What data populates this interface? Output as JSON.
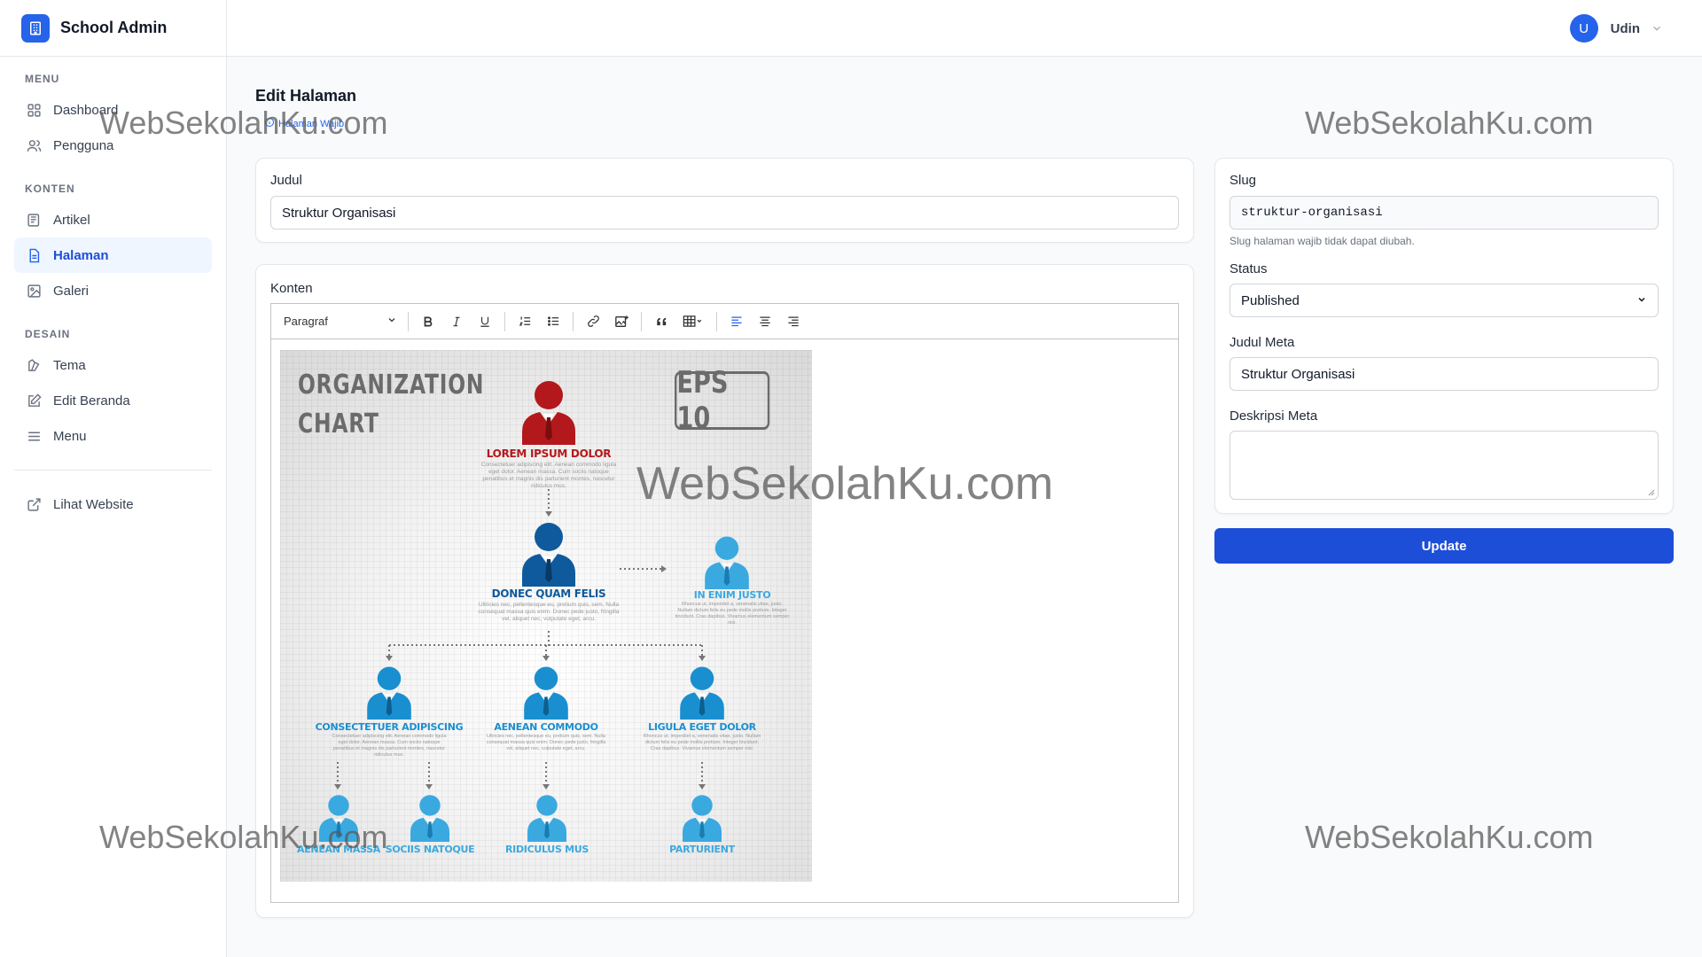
{
  "app": {
    "title": "School Admin"
  },
  "user": {
    "initial": "U",
    "name": "Udin"
  },
  "sidebar": {
    "sections": {
      "menu": "MENU",
      "konten": "KONTEN",
      "desain": "DESAIN"
    },
    "items": [
      {
        "label": "Dashboard",
        "icon": "grid-icon"
      },
      {
        "label": "Pengguna",
        "icon": "users-icon"
      },
      {
        "label": "Artikel",
        "icon": "newspaper-icon"
      },
      {
        "label": "Halaman",
        "icon": "document-icon",
        "active": true
      },
      {
        "label": "Galeri",
        "icon": "image-icon"
      },
      {
        "label": "Tema",
        "icon": "palette-icon"
      },
      {
        "label": "Edit Beranda",
        "icon": "edit-icon"
      },
      {
        "label": "Menu",
        "icon": "menu-lines-icon"
      },
      {
        "label": "Lihat Website",
        "icon": "external-link-icon"
      }
    ]
  },
  "header": {
    "title": "Edit Halaman",
    "badge": "Halaman Wajib"
  },
  "form": {
    "judul_label": "Judul",
    "judul_value": "Struktur Organisasi",
    "konten_label": "Konten",
    "editor": {
      "heading_select": "Paragraf",
      "image": {
        "title_line1": "ORGANIZATION",
        "title_line2": "CHART",
        "eps": "EPS 10",
        "nodes": {
          "top": "LOREM IPSUM DOLOR",
          "second": "DONEC QUAM FELIS",
          "side": "IN ENIM JUSTO",
          "mid1": "CONSECTETUER ADIPISCING",
          "mid2": "AENEAN COMMODO",
          "mid3": "LIGULA EGET DOLOR",
          "bot1": "AENEAN MASSA",
          "bot2": "SOCIIS NATOQUE",
          "bot3": "RIDICULUS MUS",
          "bot4": "PARTURIENT"
        },
        "desc_a": "Consectetuer adipiscing elit. Aenean commodo ligula eget dolor. Aenean massa. Cum sociis natoque penatibus et magnis dis parturient montes, nascetur ridiculus mus.",
        "desc_b": "Ultricies nec, pellentesque eu, pretium quis, sem. Nulla consequat massa quis enim. Donec pede justo, fringilla vel, aliquet nec, vulputate eget, arcu.",
        "desc_c": "Rhoncus ut, imperdiet a, venenatis vitae, justo. Nullam dictum felis eu pede mollis pretium. Integer tincidunt. Cras dapibus. Vivamus elementum semper nisi."
      }
    },
    "slug_label": "Slug",
    "slug_value": "struktur-organisasi",
    "slug_help": "Slug halaman wajib tidak dapat diubah.",
    "status_label": "Status",
    "status_value": "Published",
    "meta_title_label": "Judul Meta",
    "meta_title_value": "Struktur Organisasi",
    "meta_desc_label": "Deskripsi Meta",
    "meta_desc_value": "",
    "update_button": "Update"
  },
  "watermark": "WebSekolahKu.com",
  "colors": {
    "primary": "#2563eb",
    "button": "#1d4ed8",
    "org_red": "#b3191c",
    "org_blue_dark": "#0f5a9c",
    "org_blue": "#1a8fd0",
    "org_blue_light": "#3aa9e0"
  }
}
